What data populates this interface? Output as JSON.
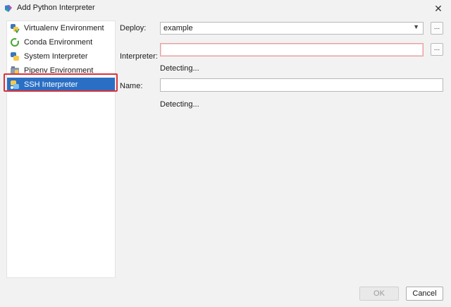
{
  "window": {
    "title": "Add Python Interpreter",
    "close_symbol": "✕"
  },
  "sidebar": {
    "items": [
      {
        "label": "Virtualenv Environment",
        "icon": "virtualenv-python-icon",
        "selected": false
      },
      {
        "label": "Conda Environment",
        "icon": "conda-ring-icon",
        "selected": false
      },
      {
        "label": "System Interpreter",
        "icon": "python-icon",
        "selected": false
      },
      {
        "label": "Pipenv Environment",
        "icon": "pipenv-icon",
        "selected": false
      },
      {
        "label": "SSH Interpreter",
        "icon": "ssh-python-icon",
        "selected": true
      }
    ]
  },
  "form": {
    "deploy_label": "Deploy:",
    "deploy_value": "example",
    "interpreter_label": "Interpreter:",
    "interpreter_value": "",
    "interpreter_status": "Detecting...",
    "name_label": "Name:",
    "name_value": "",
    "name_status": "Detecting...",
    "browse_symbol": "..."
  },
  "buttons": {
    "ok": "OK",
    "cancel": "Cancel"
  },
  "colors": {
    "selection": "#2b6fc4",
    "highlight_outline": "#d9343a",
    "error_border": "#e7a0a0"
  }
}
